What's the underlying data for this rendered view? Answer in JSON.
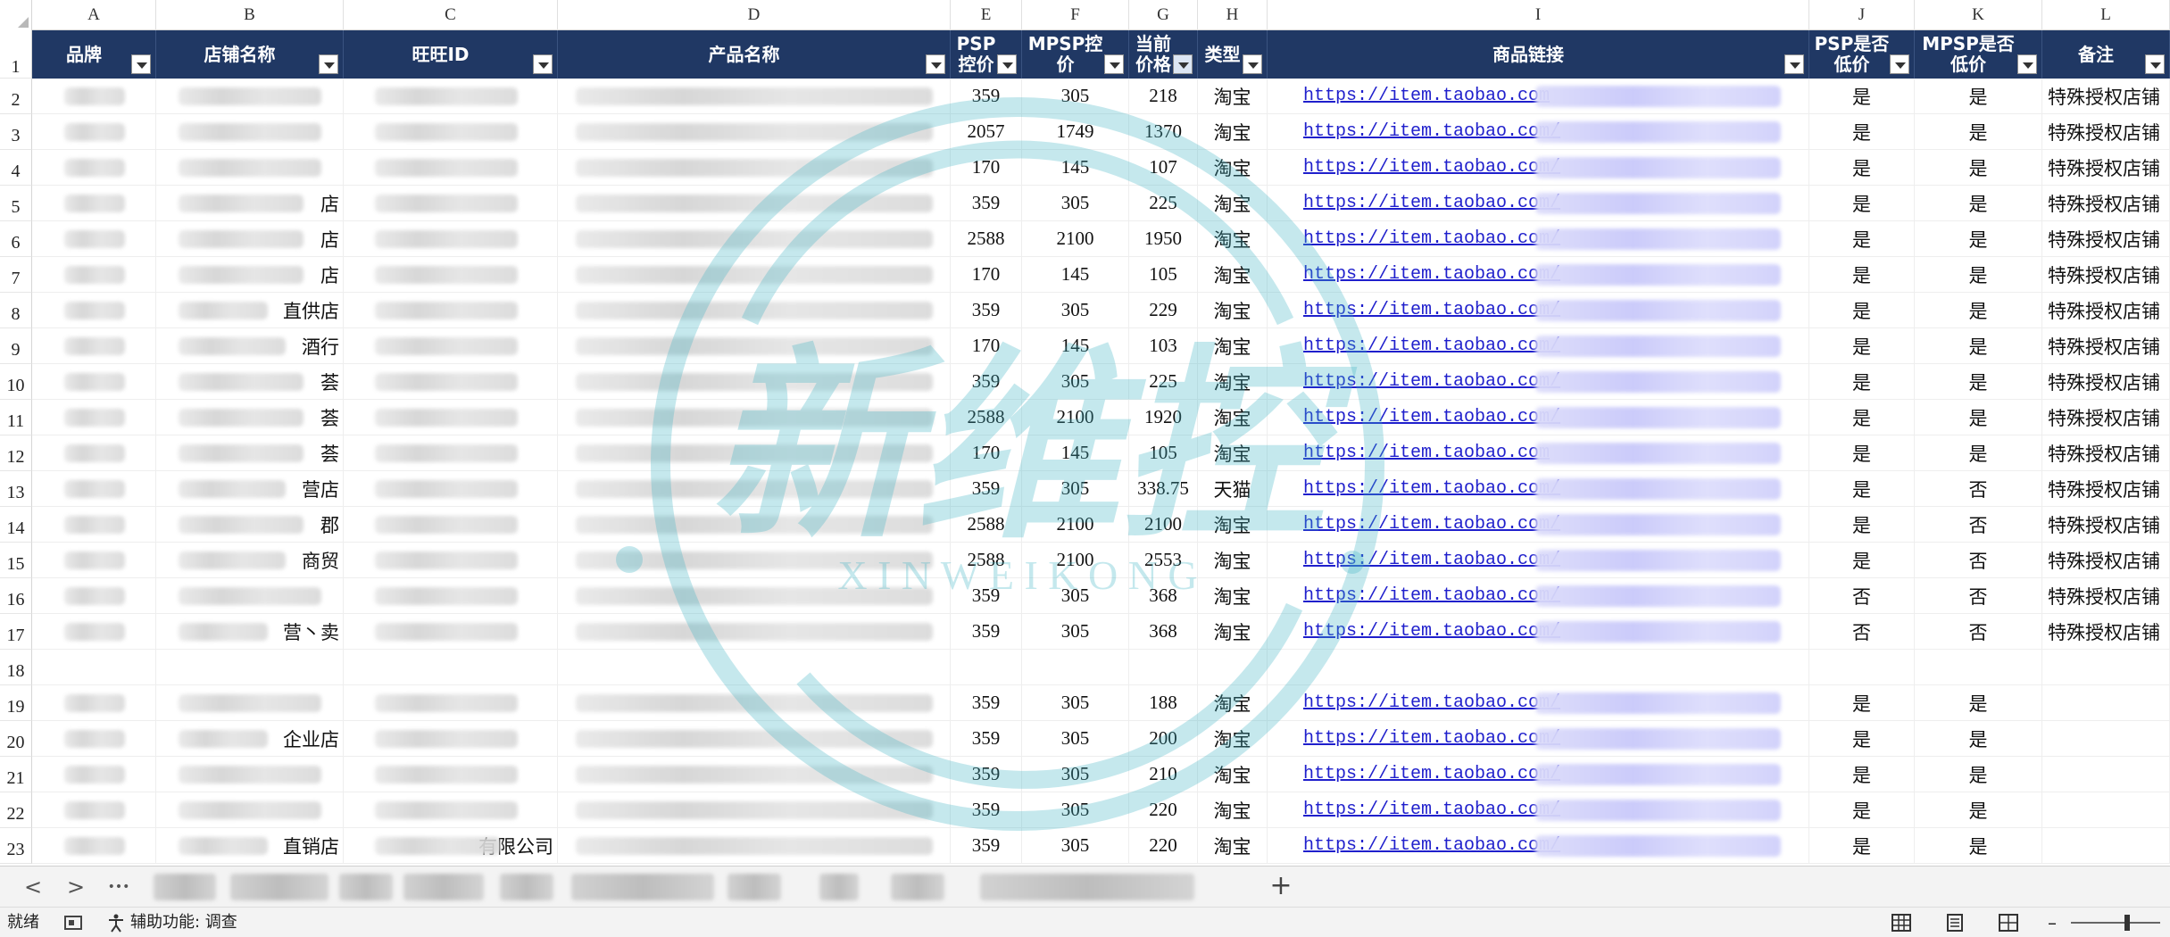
{
  "columns": [
    "A",
    "B",
    "C",
    "D",
    "E",
    "F",
    "G",
    "H",
    "I",
    "J",
    "K",
    "L"
  ],
  "headers": {
    "brand": "品牌",
    "store": "店铺名称",
    "wangwang": "旺旺ID",
    "product": "产品名称",
    "psp": "PSP控价",
    "mpsp": "MPSP控价",
    "current": "当前价格",
    "type": "类型",
    "link": "商品链接",
    "psp_low": "PSP是否低价",
    "mpsp_low": "MPSP是否低价",
    "note": "备注"
  },
  "rows": [
    {
      "n": "2",
      "store": "",
      "wangwang": "",
      "psp": "359",
      "mpsp": "305",
      "cur": "218",
      "type": "淘宝",
      "link": "https://item.taobao.com",
      "psp_low": "是",
      "mpsp_low": "是",
      "note": "特殊授权店铺"
    },
    {
      "n": "3",
      "store": "",
      "wangwang": "",
      "psp": "2057",
      "mpsp": "1749",
      "cur": "1370",
      "type": "淘宝",
      "link": "https://item.taobao.com/",
      "psp_low": "是",
      "mpsp_low": "是",
      "note": "特殊授权店铺"
    },
    {
      "n": "4",
      "store": "",
      "wangwang": "",
      "psp": "170",
      "mpsp": "145",
      "cur": "107",
      "type": "淘宝",
      "link": "https://item.taobao.com/",
      "psp_low": "是",
      "mpsp_low": "是",
      "note": "特殊授权店铺"
    },
    {
      "n": "5",
      "store": "店",
      "wangwang": "",
      "psp": "359",
      "mpsp": "305",
      "cur": "225",
      "type": "淘宝",
      "link": "https://item.taobao.com/",
      "psp_low": "是",
      "mpsp_low": "是",
      "note": "特殊授权店铺"
    },
    {
      "n": "6",
      "store": "店",
      "wangwang": "",
      "psp": "2588",
      "mpsp": "2100",
      "cur": "1950",
      "type": "淘宝",
      "link": "https://item.taobao.com/",
      "psp_low": "是",
      "mpsp_low": "是",
      "note": "特殊授权店铺"
    },
    {
      "n": "7",
      "store": "店",
      "wangwang": "",
      "psp": "170",
      "mpsp": "145",
      "cur": "105",
      "type": "淘宝",
      "link": "https://item.taobao.com/",
      "psp_low": "是",
      "mpsp_low": "是",
      "note": "特殊授权店铺"
    },
    {
      "n": "8",
      "store": "直供店",
      "wangwang": "",
      "psp": "359",
      "mpsp": "305",
      "cur": "229",
      "type": "淘宝",
      "link": "https://item.taobao.com/",
      "psp_low": "是",
      "mpsp_low": "是",
      "note": "特殊授权店铺"
    },
    {
      "n": "9",
      "store": "酒行",
      "wangwang": "",
      "psp": "170",
      "mpsp": "145",
      "cur": "103",
      "type": "淘宝",
      "link": "https://item.taobao.com/",
      "psp_low": "是",
      "mpsp_low": "是",
      "note": "特殊授权店铺"
    },
    {
      "n": "10",
      "store": "荟",
      "wangwang": "",
      "psp": "359",
      "mpsp": "305",
      "cur": "225",
      "type": "淘宝",
      "link": "https://item.taobao.com/",
      "psp_low": "是",
      "mpsp_low": "是",
      "note": "特殊授权店铺"
    },
    {
      "n": "11",
      "store": "荟",
      "wangwang": "",
      "psp": "2588",
      "mpsp": "2100",
      "cur": "1920",
      "type": "淘宝",
      "link": "https://item.taobao.com/",
      "psp_low": "是",
      "mpsp_low": "是",
      "note": "特殊授权店铺"
    },
    {
      "n": "12",
      "store": "荟",
      "wangwang": "",
      "psp": "170",
      "mpsp": "145",
      "cur": "105",
      "type": "淘宝",
      "link": "https://item.taobao.com",
      "psp_low": "是",
      "mpsp_low": "是",
      "note": "特殊授权店铺"
    },
    {
      "n": "13",
      "store": "营店",
      "wangwang": "",
      "psp": "359",
      "mpsp": "305",
      "cur": "338.75",
      "type": "天猫",
      "link": "https://item.taobao.com/",
      "psp_low": "是",
      "mpsp_low": "否",
      "note": "特殊授权店铺"
    },
    {
      "n": "14",
      "store": "郡",
      "wangwang": "",
      "psp": "2588",
      "mpsp": "2100",
      "cur": "2100",
      "type": "淘宝",
      "link": "https://item.taobao.com/",
      "psp_low": "是",
      "mpsp_low": "否",
      "note": "特殊授权店铺"
    },
    {
      "n": "15",
      "store": "商贸",
      "wangwang": "",
      "psp": "2588",
      "mpsp": "2100",
      "cur": "2553",
      "type": "淘宝",
      "link": "https://item.taobao.com/",
      "psp_low": "是",
      "mpsp_low": "否",
      "note": "特殊授权店铺"
    },
    {
      "n": "16",
      "store": "",
      "wangwang": "",
      "psp": "359",
      "mpsp": "305",
      "cur": "368",
      "type": "淘宝",
      "link": "https://item.taobao.com/",
      "psp_low": "否",
      "mpsp_low": "否",
      "note": "特殊授权店铺"
    },
    {
      "n": "17",
      "store": "营丶卖",
      "wangwang": "",
      "psp": "359",
      "mpsp": "305",
      "cur": "368",
      "type": "淘宝",
      "link": "https://item.taobao.com/",
      "psp_low": "否",
      "mpsp_low": "否",
      "note": "特殊授权店铺"
    },
    {
      "n": "18",
      "store": "",
      "wangwang": "",
      "psp": "",
      "mpsp": "",
      "cur": "",
      "type": "",
      "link": "",
      "psp_low": "",
      "mpsp_low": "",
      "note": ""
    },
    {
      "n": "19",
      "store": "",
      "wangwang": "",
      "psp": "359",
      "mpsp": "305",
      "cur": "188",
      "type": "淘宝",
      "link": "https://item.taobao.com/",
      "psp_low": "是",
      "mpsp_low": "是",
      "note": ""
    },
    {
      "n": "20",
      "store": "企业店",
      "wangwang": "",
      "psp": "359",
      "mpsp": "305",
      "cur": "200",
      "type": "淘宝",
      "link": "https://item.taobao.com/",
      "psp_low": "是",
      "mpsp_low": "是",
      "note": ""
    },
    {
      "n": "21",
      "store": "",
      "wangwang": "",
      "psp": "359",
      "mpsp": "305",
      "cur": "210",
      "type": "淘宝",
      "link": "https://item.taobao.com/",
      "psp_low": "是",
      "mpsp_low": "是",
      "note": ""
    },
    {
      "n": "22",
      "store": "",
      "wangwang": "",
      "psp": "359",
      "mpsp": "305",
      "cur": "220",
      "type": "淘宝",
      "link": "https://item.taobao.com/",
      "psp_low": "是",
      "mpsp_low": "是",
      "note": ""
    },
    {
      "n": "23",
      "store": "直销店",
      "wangwang": "有限公司",
      "psp": "359",
      "mpsp": "305",
      "cur": "220",
      "type": "淘宝",
      "link": "https://item.taobao.com/",
      "psp_low": "是",
      "mpsp_low": "是",
      "note": ""
    }
  ],
  "watermark": {
    "cn": "新维控",
    "en": "X I N   W E I   K O N G",
    "color": "#40b4c4"
  },
  "tabs": {
    "prev": "<",
    "next": ">",
    "more": "•••",
    "add": "+"
  },
  "status": {
    "ready": "就绪",
    "accessibility": "辅助功能: 调查"
  },
  "colors": {
    "header": "#203864",
    "link": "#1f1fcc"
  },
  "icons": [
    "chevron-left-icon",
    "chevron-right-icon",
    "more-icon",
    "plus-icon",
    "macro-icon",
    "accessibility-icon",
    "normal-view-icon",
    "page-layout-icon",
    "page-break-icon"
  ]
}
